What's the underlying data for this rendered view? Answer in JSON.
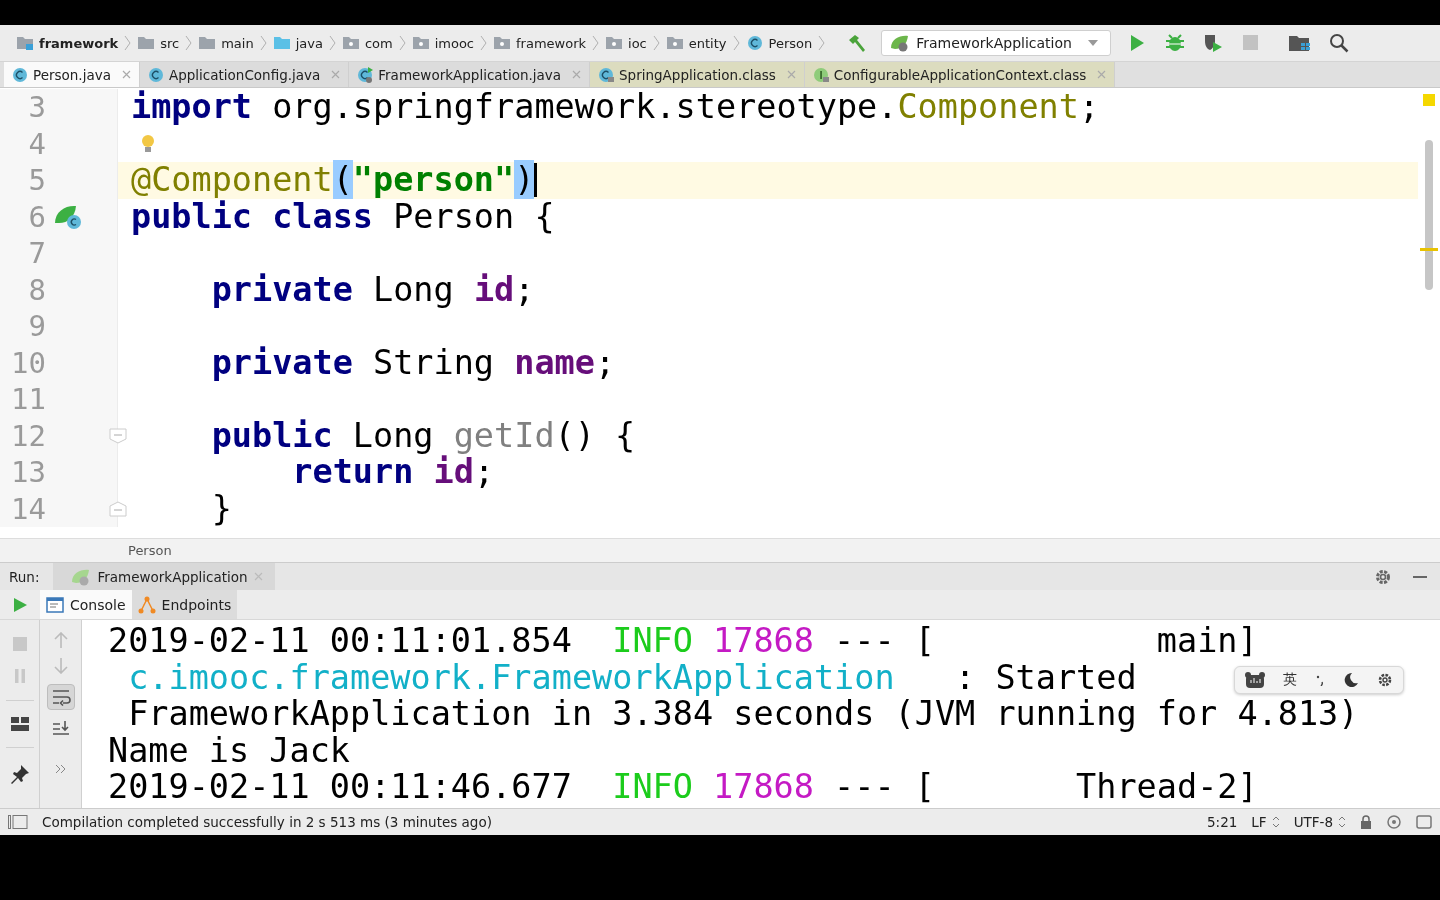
{
  "toolbar": {
    "breadcrumbs": [
      {
        "label": "framework",
        "kind": "module"
      },
      {
        "label": "src",
        "kind": "folder"
      },
      {
        "label": "main",
        "kind": "folder"
      },
      {
        "label": "java",
        "kind": "source"
      },
      {
        "label": "com",
        "kind": "package"
      },
      {
        "label": "imooc",
        "kind": "package"
      },
      {
        "label": "framework",
        "kind": "package"
      },
      {
        "label": "ioc",
        "kind": "package"
      },
      {
        "label": "entity",
        "kind": "package"
      },
      {
        "label": "Person",
        "kind": "class"
      }
    ],
    "run_config": "FrameworkApplication",
    "actions": [
      {
        "kind": "run",
        "disabled": false
      },
      {
        "kind": "debug",
        "disabled": false
      },
      {
        "kind": "coverage",
        "disabled": false
      },
      {
        "kind": "stop",
        "disabled": true
      }
    ]
  },
  "tabs": [
    {
      "label": "Person.java",
      "kind": "class",
      "selected": true
    },
    {
      "label": "ApplicationConfig.java",
      "kind": "class",
      "selected": false
    },
    {
      "label": "FrameworkApplication.java",
      "kind": "runnable",
      "selected": false
    },
    {
      "label": "SpringApplication.class",
      "kind": "library-class",
      "selected": false
    },
    {
      "label": "ConfigurableApplicationContext.class",
      "kind": "library-interface",
      "selected": false
    }
  ],
  "editor": {
    "lines": [
      {
        "number": "3",
        "tokens": [
          {
            "text": "import",
            "kind": "keyword"
          },
          {
            "text": " org.springframework.stereotype.",
            "kind": "plain"
          },
          {
            "text": "Component",
            "kind": "annotation"
          },
          {
            "text": ";",
            "kind": "plain"
          }
        ]
      },
      {
        "number": "4",
        "bulb": true
      },
      {
        "number": "5",
        "current": true,
        "caret": true,
        "tokens": [
          {
            "text": "@Component",
            "kind": "annotation"
          },
          {
            "text": "(",
            "kind": "match"
          },
          {
            "text": "\"person\"",
            "kind": "string"
          },
          {
            "text": ")",
            "kind": "match"
          }
        ]
      },
      {
        "number": "6",
        "bean": true,
        "tokens": [
          {
            "text": "public class",
            "kind": "keyword"
          },
          {
            "text": " Person {",
            "kind": "plain"
          }
        ]
      },
      {
        "number": "7"
      },
      {
        "number": "8",
        "tokens": [
          {
            "text": "    private",
            "kind": "keyword"
          },
          {
            "text": " Long ",
            "kind": "plain"
          },
          {
            "text": "id",
            "kind": "field"
          },
          {
            "text": ";",
            "kind": "plain"
          }
        ]
      },
      {
        "number": "9"
      },
      {
        "number": "10",
        "tokens": [
          {
            "text": "    private",
            "kind": "keyword"
          },
          {
            "text": " String ",
            "kind": "plain"
          },
          {
            "text": "name",
            "kind": "field"
          },
          {
            "text": ";",
            "kind": "plain"
          }
        ]
      },
      {
        "number": "11"
      },
      {
        "number": "12",
        "fold_open": true,
        "tokens": [
          {
            "text": "    public",
            "kind": "keyword"
          },
          {
            "text": " Long ",
            "kind": "plain"
          },
          {
            "text": "getId",
            "kind": "unused"
          },
          {
            "text": "() {",
            "kind": "plain"
          }
        ]
      },
      {
        "number": "13",
        "tokens": [
          {
            "text": "        return",
            "kind": "keyword"
          },
          {
            "text": " id",
            "kind": "field"
          },
          {
            "text": ";",
            "kind": "plain"
          }
        ]
      },
      {
        "number": "14",
        "fold_close": true,
        "tokens": [
          {
            "text": "    }",
            "kind": "plain"
          }
        ]
      }
    ]
  },
  "navigation_bar": {
    "label": "Person"
  },
  "run_panel": {
    "label": "Run:",
    "tab": "FrameworkApplication",
    "console_tabs": [
      {
        "label": "Console",
        "kind": "console",
        "selected": true
      },
      {
        "label": "Endpoints",
        "kind": "endpoints",
        "selected": false
      }
    ],
    "soft_wrap": true,
    "console": [
      [
        {
          "text": "2019-02-11 00:11:01.854  ",
          "kind": "plain"
        },
        {
          "text": "INFO",
          "kind": "level"
        },
        {
          "text": " 17868",
          "kind": "pid"
        },
        {
          "text": " --- [           main]",
          "kind": "plain"
        }
      ],
      [
        {
          "text": " c.imooc.framework.FrameworkApplication",
          "kind": "logger"
        },
        {
          "text": "   : Started",
          "kind": "plain"
        }
      ],
      [
        {
          "text": " FrameworkApplication in 3.384 seconds (JVM running for 4.813)",
          "kind": "plain"
        }
      ],
      [
        {
          "text": "Name is Jack",
          "kind": "plain"
        }
      ],
      [
        {
          "text": "2019-02-11 00:11:46.677  ",
          "kind": "plain"
        },
        {
          "text": "INFO",
          "kind": "level"
        },
        {
          "text": " 17868",
          "kind": "pid"
        },
        {
          "text": " --- [       Thread-2]",
          "kind": "plain"
        }
      ]
    ]
  },
  "input_method": {
    "label": "英"
  },
  "status_bar": {
    "message": "Compilation completed successfully in 2 s 513 ms (3 minutes ago)",
    "position": "5:21",
    "line_separator": "LF",
    "encoding": "UTF-8"
  }
}
